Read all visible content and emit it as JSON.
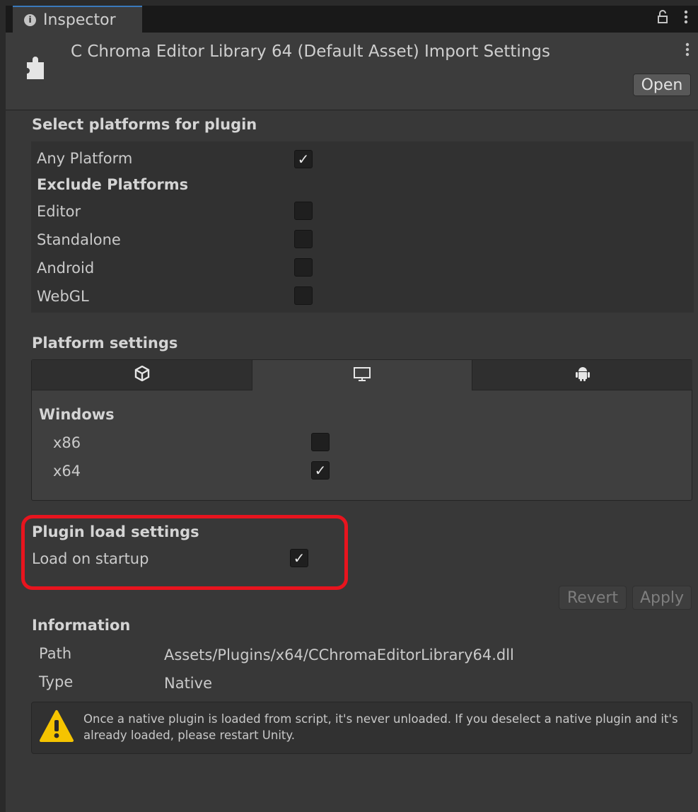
{
  "tab": {
    "icon": "info-icon",
    "label": "Inspector",
    "lock_icon": "lock-icon",
    "menu_icon": "kebab-menu-icon"
  },
  "header": {
    "icon": "plugin-puzzle-icon",
    "title": "C Chroma Editor Library 64 (Default Asset) Import Settings",
    "menu_icon": "kebab-menu-icon",
    "open_label": "Open"
  },
  "platforms": {
    "title": "Select platforms for plugin",
    "any_platform": {
      "label": "Any Platform",
      "checked": true
    },
    "exclude_title": "Exclude Platforms",
    "exclude": [
      {
        "label": "Editor",
        "checked": false
      },
      {
        "label": "Standalone",
        "checked": false
      },
      {
        "label": "Android",
        "checked": false
      },
      {
        "label": "WebGL",
        "checked": false
      }
    ]
  },
  "platform_settings": {
    "title": "Platform settings",
    "tabs": [
      {
        "icon": "unity-logo-icon",
        "active": false
      },
      {
        "icon": "monitor-icon",
        "active": true
      },
      {
        "icon": "android-icon",
        "active": false
      }
    ],
    "os_title": "Windows",
    "archs": [
      {
        "label": "x86",
        "checked": false
      },
      {
        "label": "x64",
        "checked": true
      }
    ]
  },
  "load_settings": {
    "title": "Plugin load settings",
    "load_on_startup": {
      "label": "Load on startup",
      "checked": true
    }
  },
  "actions": {
    "revert": "Revert",
    "apply": "Apply"
  },
  "information": {
    "title": "Information",
    "path_label": "Path",
    "path_value": "Assets/Plugins/x64/CChromaEditorLibrary64.dll",
    "type_label": "Type",
    "type_value": "Native",
    "warning_icon": "warning-icon",
    "warning": "Once a native plugin is loaded from script, it's never unloaded. If you deselect a native plugin and it's already loaded, please restart Unity."
  },
  "colors": {
    "highlight": "#e8141e",
    "warning": "#f5c400",
    "tab_accent": "#3a79bb"
  }
}
